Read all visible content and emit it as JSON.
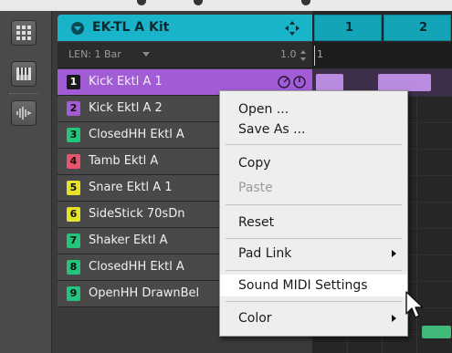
{
  "group": {
    "title": "EK-TL A Kit",
    "collapse_icon": "chevron-down-icon",
    "move_icon": "move-arrows-icon"
  },
  "length_row": {
    "label": "LEN: 1 Bar",
    "value": "1.0"
  },
  "pattern": {
    "bars": [
      "1",
      "2"
    ],
    "ruler_marker": "1"
  },
  "sounds": [
    {
      "number": "1",
      "name": "Kick Ektl A 1",
      "color": "#a25cd6",
      "selected": true
    },
    {
      "number": "2",
      "name": "Kick Ektl A 2",
      "color": "#a25cd6"
    },
    {
      "number": "3",
      "name": "ClosedHH Ektl A",
      "color": "#23c47b"
    },
    {
      "number": "4",
      "name": "Tamb Ektl A",
      "color": "#e8556a"
    },
    {
      "number": "5",
      "name": "Snare Ektl A 1",
      "color": "#e6e22a"
    },
    {
      "number": "6",
      "name": "SideStick 70sDn",
      "color": "#e6e22a"
    },
    {
      "number": "7",
      "name": "Shaker Ektl A",
      "color": "#23c47b"
    },
    {
      "number": "8",
      "name": "ClosedHH Ektl A",
      "color": "#23c47b"
    },
    {
      "number": "9",
      "name": "OpenHH DrawnBel",
      "color": "#23c47b"
    }
  ],
  "context_menu": {
    "items": [
      {
        "label": "Open ..."
      },
      {
        "label": "Save As ..."
      },
      {
        "label": "Copy"
      },
      {
        "label": "Paste",
        "disabled": true
      },
      {
        "label": "Reset"
      },
      {
        "label": "Pad Link",
        "submenu": true
      },
      {
        "label": "Sound MIDI Settings",
        "hovered": true
      },
      {
        "label": "Color",
        "submenu": true
      }
    ]
  },
  "tools": [
    "pattern-grid-icon",
    "keyboard-icon",
    "waveform-icon"
  ]
}
